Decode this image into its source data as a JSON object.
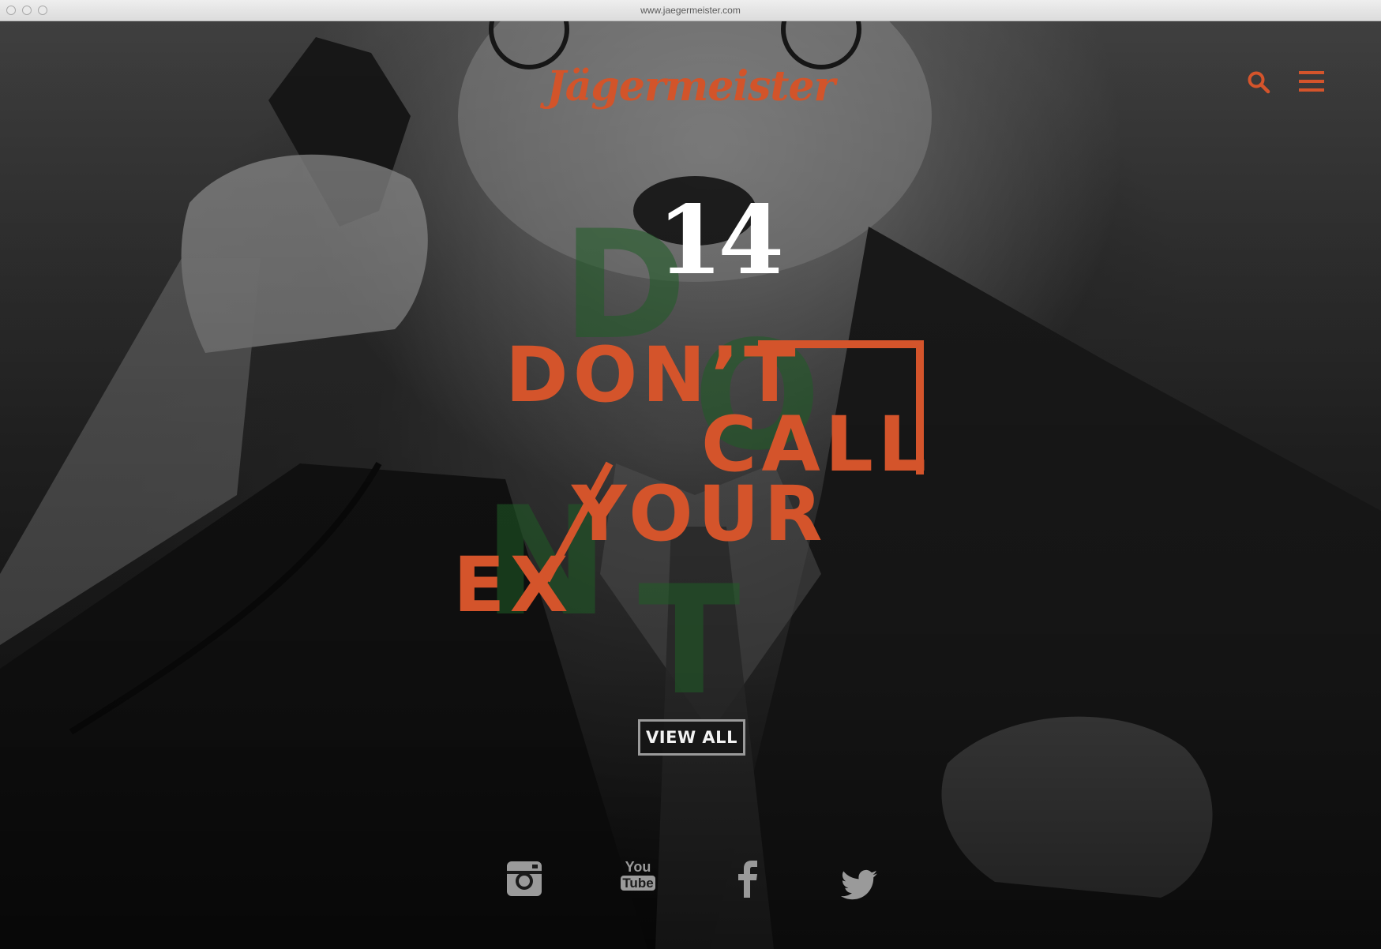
{
  "browser": {
    "url": "www.jaegermeister.com"
  },
  "header": {
    "logo_text": "Jägermeister",
    "icons": [
      "search-icon",
      "menu-icon"
    ]
  },
  "hero": {
    "number": "14",
    "headline_lines": [
      "DON’T",
      "CALL",
      "YOUR",
      "EX"
    ],
    "background_letters": [
      "D",
      "O",
      "N",
      "T"
    ],
    "view_all_label": "VIEW ALL"
  },
  "social": {
    "icons": [
      "instagram-icon",
      "youtube-icon",
      "facebook-icon",
      "twitter-icon"
    ],
    "youtube_top": "You",
    "youtube_bottom": "Tube"
  },
  "colors": {
    "accent": "#d4542b",
    "green_overlay": "#1f5d26",
    "background": "#0d0d0d"
  }
}
